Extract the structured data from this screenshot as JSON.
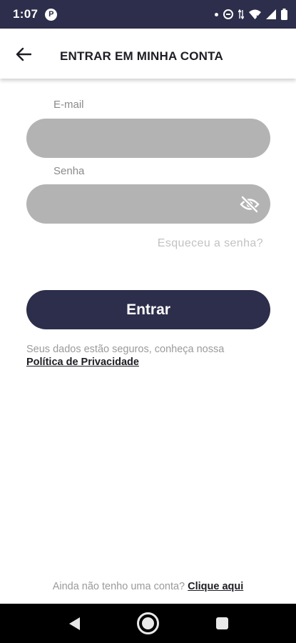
{
  "status_bar": {
    "time": "1:07",
    "app_icon_glyph": "P"
  },
  "header": {
    "title": "ENTRAR EM MINHA CONTA",
    "back_icon": "arrow-left-icon"
  },
  "form": {
    "email_label": "E-mail",
    "email_value": "",
    "password_label": "Senha",
    "password_value": "",
    "password_toggle_icon": "eye-off-icon",
    "forgot_password": "Esqueceu a senha?",
    "submit_label": "Entrar"
  },
  "privacy": {
    "text": "Seus dados estão seguros, conheça nossa",
    "link": "Política de Privacidade"
  },
  "signup": {
    "text": "Ainda não tenho uma conta?",
    "link": "Clique aqui"
  },
  "colors": {
    "primary": "#2d2e4b",
    "input_background": "#b3b3b3",
    "muted_text": "#9a9a9a"
  }
}
